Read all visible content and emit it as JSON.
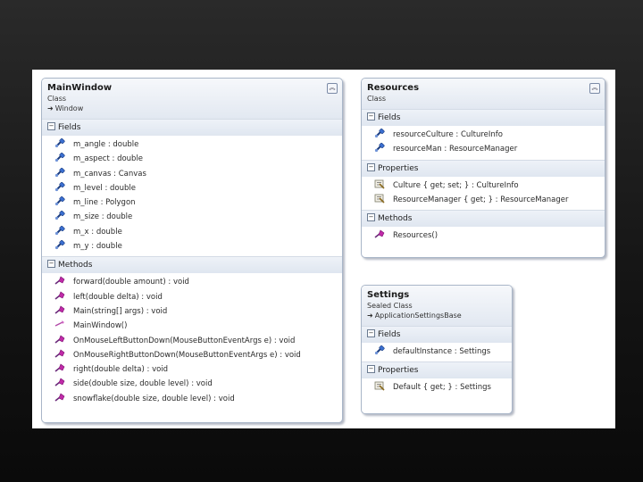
{
  "classes": {
    "main_window": {
      "name": "MainWindow",
      "kind": "Class",
      "base": "Window",
      "fields_label": "Fields",
      "fields": [
        "m_angle : double",
        "m_aspect : double",
        "m_canvas : Canvas",
        "m_level : double",
        "m_line : Polygon",
        "m_size : double",
        "m_x : double",
        "m_y : double"
      ],
      "methods_label": "Methods",
      "methods": [
        "forward(double amount) : void",
        "left(double delta) : void",
        "Main(string[] args) : void",
        "MainWindow()",
        "OnMouseLeftButtonDown(MouseButtonEventArgs e) : void",
        "OnMouseRightButtonDown(MouseButtonEventArgs e) : void",
        "right(double delta) : void",
        "side(double size, double level) : void",
        "snowflake(double size, double level) : void"
      ]
    },
    "resources": {
      "name": "Resources",
      "kind": "Class",
      "fields_label": "Fields",
      "fields": [
        "resourceCulture : CultureInfo",
        "resourceMan : ResourceManager"
      ],
      "properties_label": "Properties",
      "properties": [
        "Culture { get; set; } : CultureInfo",
        "ResourceManager { get; } : ResourceManager"
      ],
      "methods_label": "Methods",
      "methods": [
        "Resources()"
      ]
    },
    "settings": {
      "name": "Settings",
      "kind": "Sealed Class",
      "base": "ApplicationSettingsBase",
      "fields_label": "Fields",
      "fields": [
        "defaultInstance : Settings"
      ],
      "properties_label": "Properties",
      "properties": [
        "Default { get; } : Settings"
      ]
    }
  },
  "icons": {
    "collapse": "double-chevron-up-icon",
    "section_toggle": "minus-box-icon",
    "base_arrow": "inheritance-arrow-icon",
    "field": "field-icon",
    "method": "method-icon",
    "property": "property-icon",
    "constructor": "constructor-icon"
  },
  "colors": {
    "header_top": "#f6f8fb",
    "header_bottom": "#e2e8f1",
    "border": "#a9b6c8",
    "field_blue": "#2d5fb0",
    "method_magenta": "#b0209a"
  }
}
